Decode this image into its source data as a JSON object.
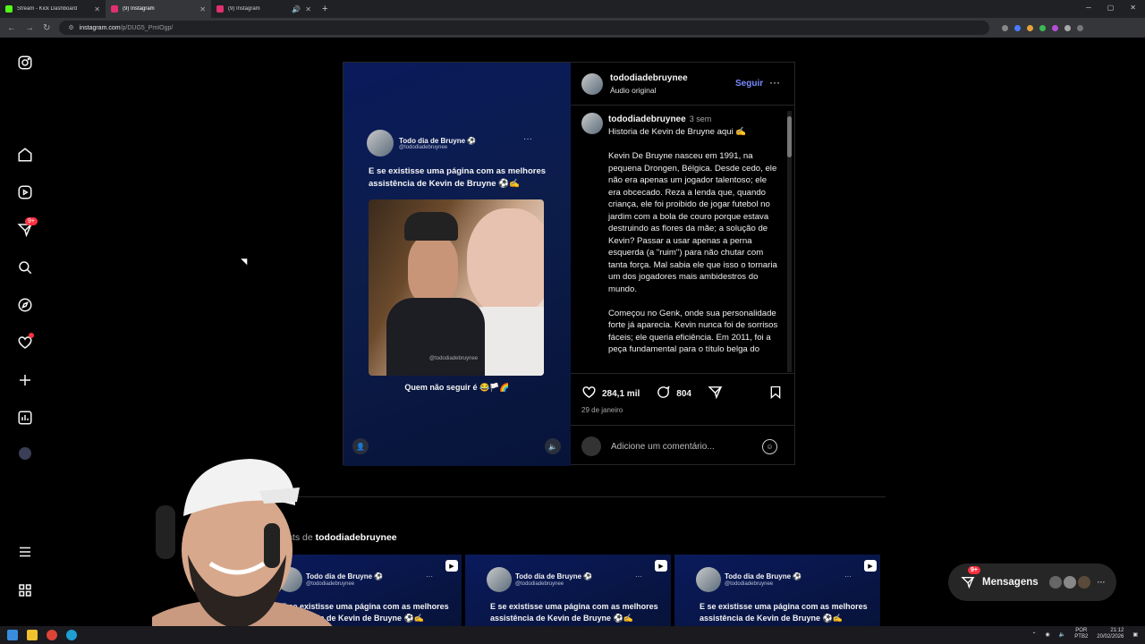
{
  "browser": {
    "tabs": [
      {
        "title": "Stream - Kick Dashboard",
        "color": "#53fc18",
        "active": false
      },
      {
        "title": "(9) Instagram",
        "color": "#e1306c",
        "active": true
      },
      {
        "title": "(9) Instagram",
        "color": "#e1306c",
        "active": false
      }
    ],
    "url_host": "instagram.com",
    "url_path": "/p/DUG5_PmIOgp/"
  },
  "sidebar": {
    "notifications_badge": "9+"
  },
  "post": {
    "card": {
      "name": "Todo dia de Bruyne ⚽",
      "handle": "@tododiadebruynee",
      "text": "E se existisse uma página com as melhores assistência de Kevin de Bruyne ⚽✍️",
      "watermark": "@tododiadebruynee",
      "caption": "Quem não seguir é 😂🏳️🌈"
    },
    "author": {
      "username": "tododiadebruynee",
      "audio": "Áudio original",
      "follow_label": "Seguir"
    },
    "comment": {
      "username": "tododiadebruynee",
      "time": "3 sem",
      "body": "Historia de Kevin de Bruyne aqui ✍️\n\nKevin De Bruyne nasceu em 1991, na pequena Drongen, Bélgica. Desde cedo, ele não era apenas um jogador talentoso; ele era obcecado. Reza a lenda que, quando criança, ele foi proibido de jogar futebol no jardim com a bola de couro porque estava destruindo as flores da mãe; a solução de Kevin? Passar a usar apenas a perna esquerda (a \"ruim\") para não chutar com tanta força. Mal sabia ele que isso o tornaria um dos jogadores mais ambidestros do mundo.\n\nComeçou no Genk, onde sua personalidade forte já aparecia. Kevin nunca foi de sorrisos fáceis; ele queria eficiência. Em 2011, foi a peça fundamental para o título belga do"
    },
    "likes": "284,1 mil",
    "comments_count": "804",
    "date": "29 de janeiro",
    "add_comment_placeholder": "Adicione um comentário..."
  },
  "more_posts": {
    "prefix": "posts de",
    "username": "tododiadebruynee",
    "tiles": [
      {
        "name": "Todo dia de Bruyne ⚽",
        "handle": "@tododiadebruynee",
        "text": "E se existisse uma página com as melhores assistência de Kevin de Bruyne ⚽✍️"
      },
      {
        "name": "Todo dia de Bruyne ⚽",
        "handle": "@tododiadebruynee",
        "text": "E se existisse uma página com as melhores assistência de Kevin de Bruyne ⚽✍️"
      },
      {
        "name": "Todo dia de Bruyne ⚽",
        "handle": "@tododiadebruynee",
        "text": "E se existisse uma página com as melhores assistência de Kevin de Bruyne ⚽✍️"
      }
    ]
  },
  "messages": {
    "label": "Mensagens",
    "badge": "9+"
  },
  "taskbar": {
    "lang_top": "POR",
    "lang_bottom": "PTB2",
    "time": "21:12",
    "date": "20/02/2026"
  }
}
